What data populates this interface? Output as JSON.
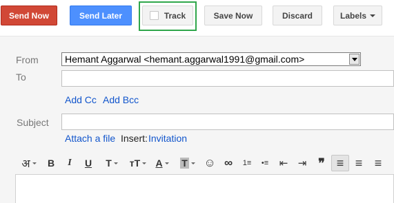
{
  "toolbar": {
    "send_now": "Send Now",
    "send_later": "Send Later",
    "track": "Track",
    "save_now": "Save Now",
    "discard": "Discard",
    "labels": "Labels"
  },
  "compose": {
    "from_label": "From",
    "from_value": "Hemant Aggarwal <hemant.aggarwal1991@gmail.com>",
    "to_label": "To",
    "to_value": "",
    "add_cc": "Add Cc",
    "add_bcc": "Add Bcc",
    "subject_label": "Subject",
    "subject_value": "",
    "attach_file": "Attach a file",
    "insert_label": "Insert:",
    "invitation": "Invitation"
  },
  "format_toolbar": {
    "input_tools": "अ",
    "bold": "B",
    "italic": "I",
    "underline": "U",
    "font": "T",
    "size": "тT",
    "text_color": "A",
    "highlight": "T",
    "emoji": "☺",
    "link": "∞",
    "numbered_list": "1≡",
    "bulleted_list": "•≡",
    "indent_less": "⇤",
    "indent_more": "⇥",
    "quote": "❞",
    "align_left": "≡",
    "align_center": "≡",
    "align_right": "≡"
  },
  "colors": {
    "send_now_bg": "#d14836",
    "send_later_bg": "#4d90fe",
    "track_highlight": "#2ea64a",
    "link_color": "#1155cc"
  }
}
